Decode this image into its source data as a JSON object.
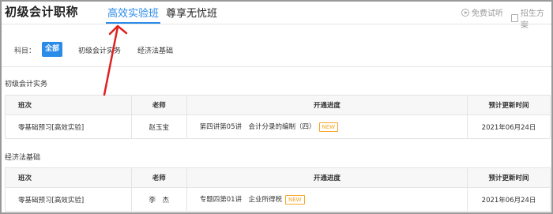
{
  "header": {
    "title": "初级会计职称",
    "tabs": [
      {
        "label": "高效实验班",
        "active": true
      },
      {
        "label": "尊享无忧班",
        "active": false
      }
    ],
    "links": [
      {
        "label": "免费试听",
        "icon": "play-circle-icon"
      },
      {
        "label": "招生方案",
        "icon": "document-icon"
      }
    ],
    "accent_color": "#2b8be8"
  },
  "filter": {
    "label": "科目：",
    "options": [
      "全部",
      "初级会计实务",
      "经济法基础"
    ],
    "selected": "全部"
  },
  "sections": [
    {
      "title": "初级会计实务",
      "columns": [
        "班次",
        "老师",
        "开通进度",
        "预计更新时间"
      ],
      "rows": [
        {
          "class": "零基础预习[高效实验]",
          "teacher": "赵玉宝",
          "progress": "第四讲第05讲　会计分录的编制（四）",
          "badge": "NEW",
          "date": "2021年06月24日"
        }
      ]
    },
    {
      "title": "经济法基础",
      "columns": [
        "班次",
        "老师",
        "开通进度",
        "预计更新时间"
      ],
      "rows": [
        {
          "class": "零基础预习[高效实验]",
          "teacher": "李　杰",
          "progress": "专题四第01讲　企业所得税",
          "badge": "NEW",
          "date": "2021年06月24日"
        }
      ]
    }
  ],
  "annotation": {
    "color": "#e02020"
  }
}
